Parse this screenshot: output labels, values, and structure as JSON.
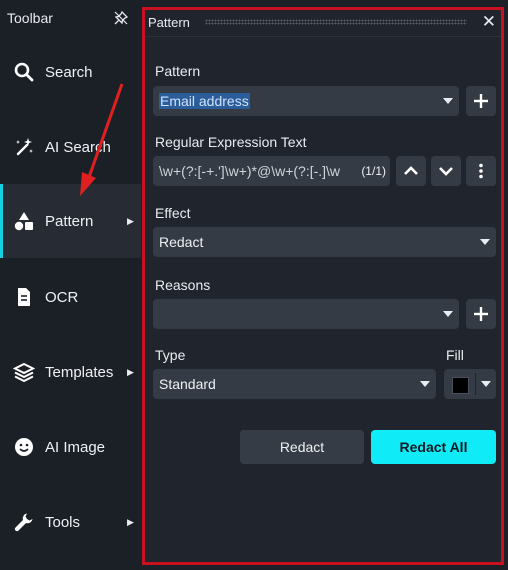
{
  "sidebar": {
    "title": "Toolbar",
    "items": [
      {
        "label": "Search",
        "icon": "search-icon"
      },
      {
        "label": "AI Search",
        "icon": "sparkle-wand-icon"
      },
      {
        "label": "Pattern",
        "icon": "shapes-icon",
        "active": true,
        "has_submenu": true
      },
      {
        "label": "OCR",
        "icon": "document-icon"
      },
      {
        "label": "Templates",
        "icon": "layers-icon",
        "has_submenu": true
      },
      {
        "label": "AI Image",
        "icon": "smiley-icon"
      },
      {
        "label": "Tools",
        "icon": "wrench-icon",
        "has_submenu": true
      }
    ]
  },
  "panel": {
    "title": "Pattern",
    "pattern": {
      "label": "Pattern",
      "value": "Email address"
    },
    "regex": {
      "label": "Regular Expression Text",
      "value": "\\w+(?:[-+.']\\w+)*@\\w+(?:[-.]\\w",
      "match_count": "(1/1)"
    },
    "effect": {
      "label": "Effect",
      "value": "Redact"
    },
    "reasons": {
      "label": "Reasons",
      "value": ""
    },
    "type": {
      "label": "Type",
      "value": "Standard"
    },
    "fill": {
      "label": "Fill",
      "color": "#000000"
    },
    "buttons": {
      "redact": "Redact",
      "redact_all": "Redact All"
    }
  },
  "colors": {
    "accent": "#18cfe0",
    "annotation": "#c8101e",
    "arrow": "#e02020"
  }
}
